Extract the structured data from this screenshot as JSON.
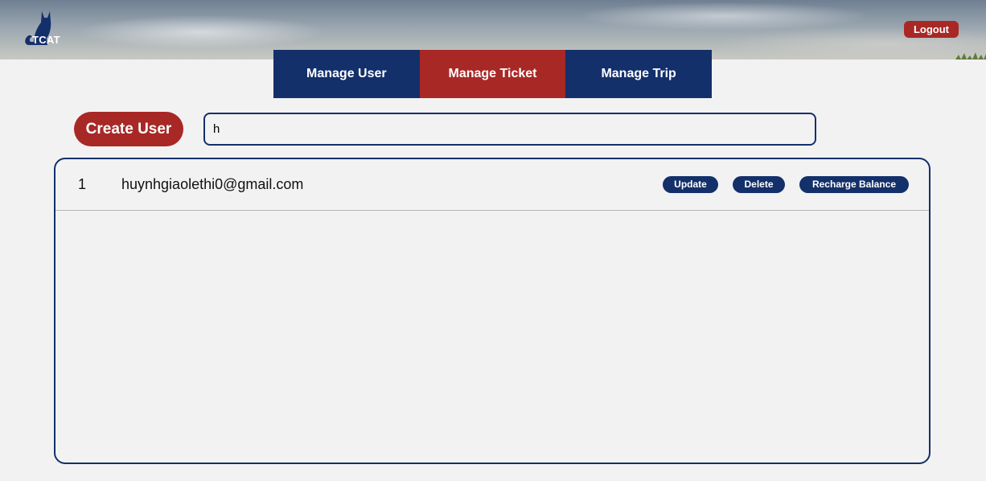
{
  "header": {
    "logo_text": "TCAT",
    "logout_label": "Logout"
  },
  "tabs": [
    {
      "label": "Manage User",
      "active": false
    },
    {
      "label": "Manage Ticket",
      "active": true
    },
    {
      "label": "Manage Trip",
      "active": false
    }
  ],
  "toolbar": {
    "create_label": "Create User",
    "search_value": "h"
  },
  "users": [
    {
      "index": "1",
      "email": "huynhgiaolethi0@gmail.com",
      "actions": {
        "update": "Update",
        "delete": "Delete",
        "recharge": "Recharge Balance"
      }
    }
  ],
  "colors": {
    "navy": "#13306b",
    "red": "#a82826",
    "background": "#f2f2f2"
  },
  "icons": {
    "logo": "cat-icon",
    "grass": "grass-icon"
  }
}
